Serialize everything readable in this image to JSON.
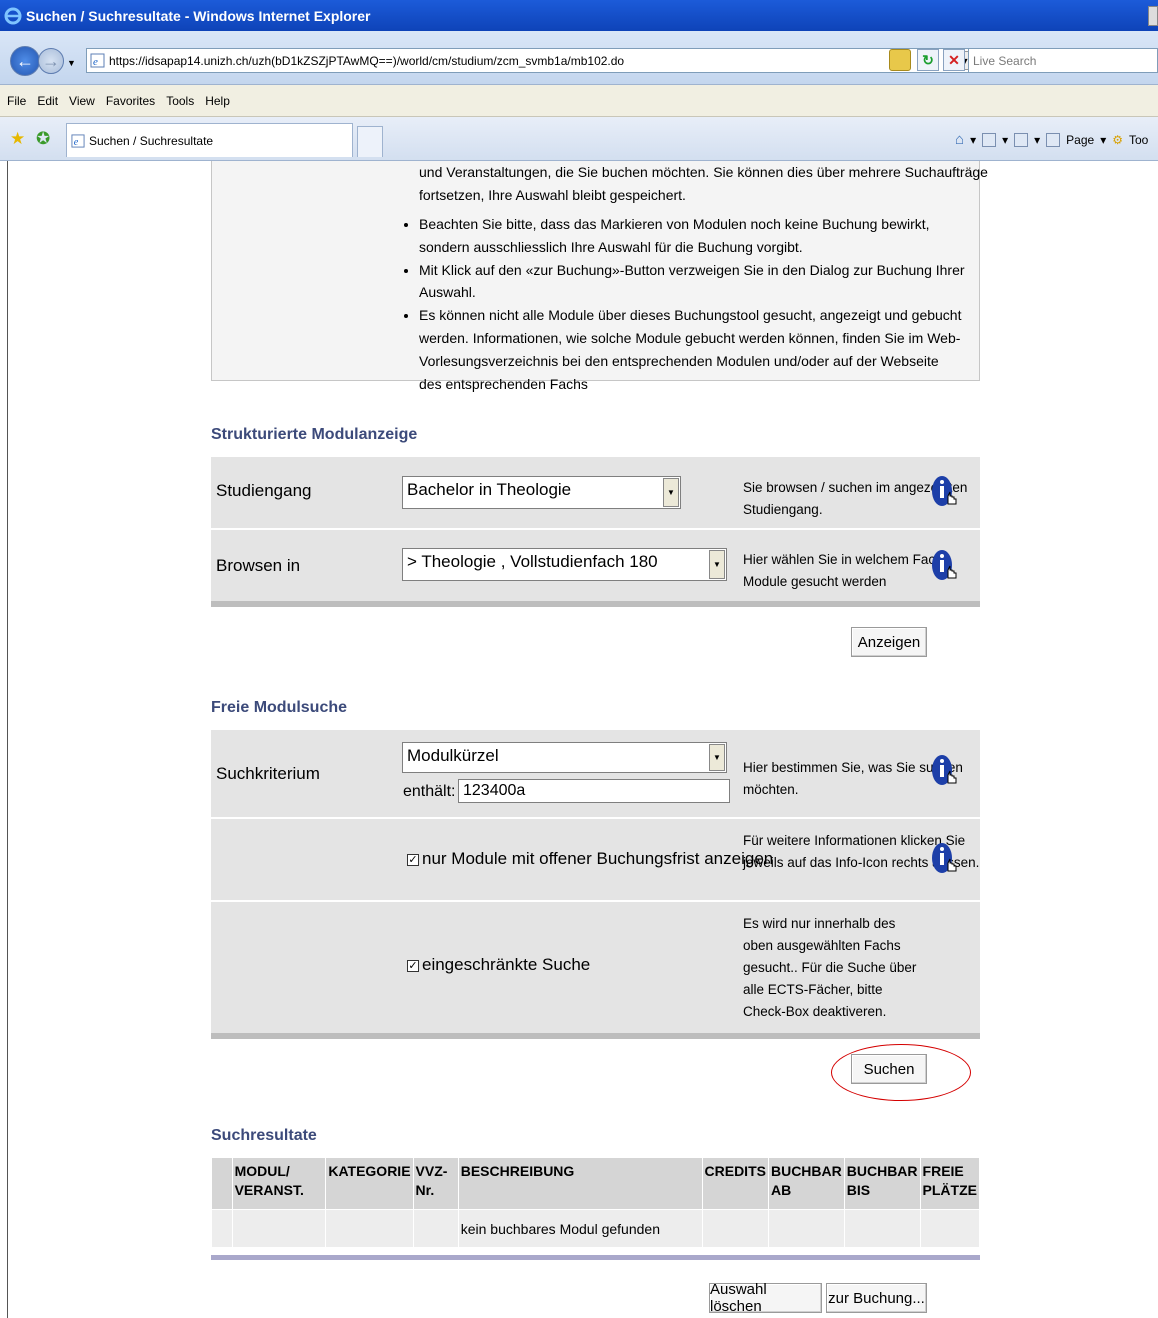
{
  "window": {
    "title": "Suchen / Suchresultate - Windows Internet Explorer"
  },
  "browser": {
    "url": "https://idsapap14.unizh.ch/uzh(bD1kZSZjPTAwMQ==)/world/cm/studium/zcm_svmb1a/mb102.do",
    "search_placeholder": "Live Search",
    "menu": [
      "File",
      "Edit",
      "View",
      "Favorites",
      "Tools",
      "Help"
    ],
    "tab_title": "Suchen / Suchresultate",
    "command_bar": {
      "page": "Page",
      "tools": "Too"
    }
  },
  "info": {
    "partial_line": "und Veranstaltungen, die Sie buchen möchten. Sie können dies über mehrere Suchaufträge",
    "partial_line2": "fortsetzen, Ihre Auswahl bleibt gespeichert.",
    "bullets": [
      "Beachten Sie bitte, dass das Markieren von Modulen noch keine Buchung bewirkt, sondern ausschliesslich Ihre Auswahl für die Buchung vorgibt.",
      "Mit Klick auf den «zur Buchung»-Button verzweigen Sie in den Dialog zur Buchung Ihrer Auswahl.",
      "Es können nicht alle Module über dieses Buchungstool gesucht, angezeigt und gebucht werden. Informationen, wie solche Module gebucht werden können, finden Sie im Web-Vorlesungsverzeichnis bei den entsprechenden Modulen und/oder auf der Webseite des entsprechenden Fachs"
    ]
  },
  "structured": {
    "title": "Strukturierte Modulanzeige",
    "studiengang_label": "Studiengang",
    "studiengang_value": "Bachelor in Theologie",
    "studiengang_help": "Sie browsen / suchen im angezeigten Studiengang.",
    "browse_label": "Browsen in",
    "browse_value": "> Theologie , Vollstudienfach 180",
    "browse_help": "Hier wählen Sie in welchem Fach Module gesucht werden",
    "show_button": "Anzeigen"
  },
  "free_search": {
    "title": "Freie Modulsuche",
    "criterion_label": "Suchkriterium",
    "criterion_value": "Modulkürzel",
    "contains_label": "enthält:",
    "contains_value": "123400a",
    "criterion_help": "Hier bestimmen Sie, was Sie suchen möchten.",
    "open_only_label": "nur Module mit offener Buchungsfrist anzeigen",
    "open_only_checked": true,
    "open_only_help": "Für weitere Informationen klicken Sie jeweils auf das Info-Icon rechts aussen.",
    "restricted_label": "eingeschränkte Suche",
    "restricted_checked": true,
    "restricted_help": "Es wird nur innerhalb des oben ausgewählten Fachs gesucht.. Für die Suche über alle ECTS-Fächer, bitte Check-Box deaktiveren.",
    "search_button": "Suchen"
  },
  "results": {
    "title": "Suchresultate",
    "columns": [
      "MODUL/ VERANST.",
      "KATEGORIE",
      "VVZ-Nr.",
      "BESCHREIBUNG",
      "CREDITS",
      "BUCHBAR AB",
      "BUCHBAR BIS",
      "FREIE PLÄTZE"
    ],
    "empty_message": "kein buchbares Modul gefunden",
    "clear_button": "Auswahl löschen",
    "book_button": "zur Buchung..."
  },
  "colors": {
    "section_title": "#3c4a7a",
    "highlight_ellipse": "#d40000",
    "info_icon": "#1d3fa8"
  }
}
